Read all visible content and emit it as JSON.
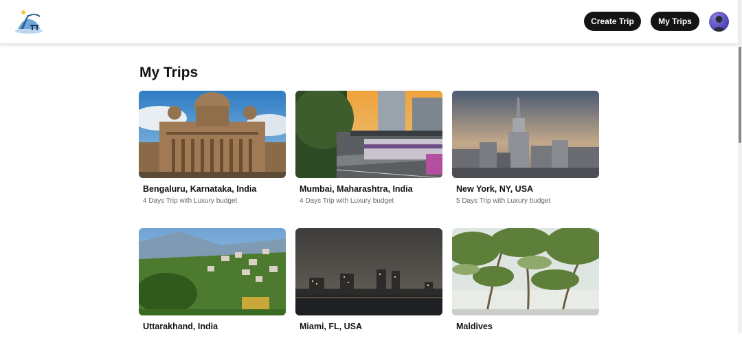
{
  "header": {
    "logo_icon": "travel-logo-icon",
    "create_trip_label": "Create Trip",
    "my_trips_label": "My Trips",
    "avatar_icon": "user-avatar"
  },
  "page": {
    "title": "My Trips"
  },
  "trips": [
    {
      "place": "Bengaluru, Karnataka, India",
      "summary": "4 Days Trip with Luxury budget"
    },
    {
      "place": "Mumbai, Maharashtra, India",
      "summary": "4 Days Trip with Luxury budget"
    },
    {
      "place": "New York, NY, USA",
      "summary": "5 Days Trip with Luxury budget"
    },
    {
      "place": "Uttarakhand, India",
      "summary": ""
    },
    {
      "place": "Miami, FL, USA",
      "summary": ""
    },
    {
      "place": "Maldives",
      "summary": ""
    }
  ],
  "colors": {
    "button_bg": "#141414",
    "button_text": "#ffffff",
    "subtext": "#666666"
  }
}
